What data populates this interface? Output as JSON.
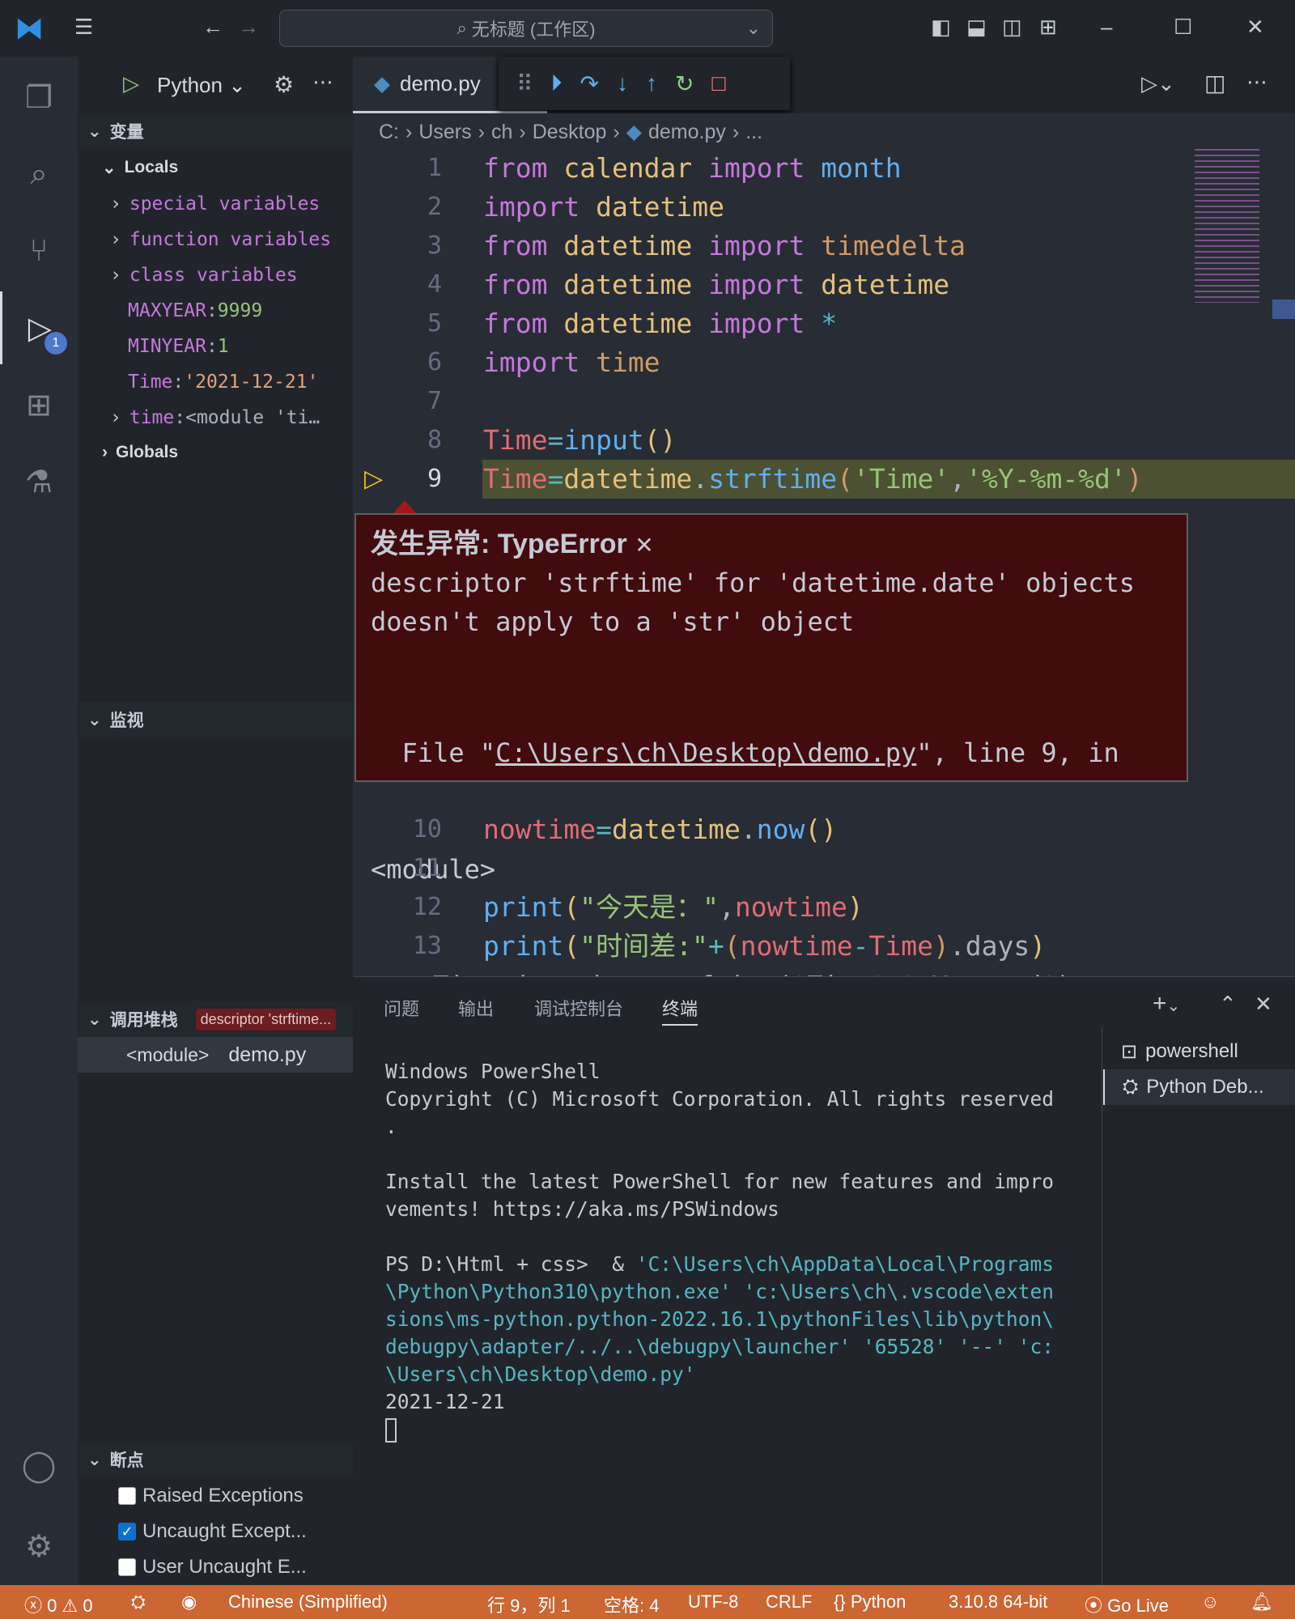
{
  "titlebar": {
    "title": "无标题 (工作区)",
    "search_icon": "search-icon"
  },
  "sidebar": {
    "run_config": "Python",
    "variables_header": "变量",
    "locals_label": "Locals",
    "locals": [
      {
        "label": "special variables",
        "expandable": true
      },
      {
        "label": "function variables",
        "expandable": true
      },
      {
        "label": "class variables",
        "expandable": true
      },
      {
        "name": "MAXYEAR",
        "value": "9999"
      },
      {
        "name": "MINYEAR",
        "value": "1"
      },
      {
        "name": "Time",
        "value": "'2021-12-21'"
      },
      {
        "name": "time",
        "value": "<module 'ti…",
        "expandable": true
      }
    ],
    "globals_label": "Globals",
    "watch_header": "监视",
    "callstack_header": "调用堆栈",
    "callstack_badge": "descriptor 'strftime...",
    "callstack_frame": {
      "name": "<module>",
      "file": "demo.py"
    },
    "breakpoints_header": "断点",
    "breakpoints": [
      {
        "label": "Raised Exceptions",
        "checked": false
      },
      {
        "label": "Uncaught Except...",
        "checked": true
      },
      {
        "label": "User Uncaught E...",
        "checked": false
      }
    ],
    "debug_badge": "1"
  },
  "tabs": [
    {
      "label": "demo.py",
      "active": true
    }
  ],
  "breadcrumb": [
    "C:",
    "Users",
    "ch",
    "Desktop",
    "demo.py",
    "..."
  ],
  "code_lines": [
    {
      "n": "1",
      "tokens": [
        [
          "from ",
          "k"
        ],
        [
          "calendar ",
          "m"
        ],
        [
          "import ",
          "k"
        ],
        [
          "month",
          "f"
        ]
      ]
    },
    {
      "n": "2",
      "tokens": [
        [
          "import ",
          "k"
        ],
        [
          "datetime",
          "m"
        ]
      ]
    },
    {
      "n": "3",
      "tokens": [
        [
          "from ",
          "k"
        ],
        [
          "datetime ",
          "m"
        ],
        [
          "import ",
          "k"
        ],
        [
          "timedelta",
          "t"
        ]
      ]
    },
    {
      "n": "4",
      "tokens": [
        [
          "from ",
          "k"
        ],
        [
          "datetime ",
          "m"
        ],
        [
          "import ",
          "k"
        ],
        [
          "datetime",
          "m"
        ]
      ]
    },
    {
      "n": "5",
      "tokens": [
        [
          "from ",
          "k"
        ],
        [
          "datetime ",
          "m"
        ],
        [
          "import ",
          "k"
        ],
        [
          "*",
          "o"
        ]
      ]
    },
    {
      "n": "6",
      "tokens": [
        [
          "import ",
          "k"
        ],
        [
          "time",
          "t"
        ]
      ]
    },
    {
      "n": "7",
      "tokens": []
    },
    {
      "n": "8",
      "tokens": [
        [
          "Time",
          "v"
        ],
        [
          "=",
          "o"
        ],
        [
          "input",
          "f"
        ],
        [
          "()",
          "y"
        ]
      ]
    },
    {
      "n": "9",
      "tokens": [
        [
          "Time",
          "v"
        ],
        [
          "=",
          "o"
        ],
        [
          "datetime",
          "m"
        ],
        [
          ".",
          "d"
        ],
        [
          "strftime",
          "f"
        ],
        [
          "(",
          "p"
        ],
        [
          "'Time'",
          "s"
        ],
        [
          ",",
          "d"
        ],
        [
          "'%Y-%m-%d'",
          "s"
        ],
        [
          ")",
          "p"
        ]
      ]
    }
  ],
  "code_lines_after": [
    {
      "n": "10",
      "tokens": [
        [
          "nowtime",
          "v"
        ],
        [
          "=",
          "o"
        ],
        [
          "datetime",
          "m"
        ],
        [
          ".",
          "d"
        ],
        [
          "now",
          "f"
        ],
        [
          "()",
          "y"
        ]
      ]
    },
    {
      "n": "11",
      "tokens": []
    },
    {
      "n": "12",
      "tokens": [
        [
          "print",
          "f"
        ],
        [
          "(",
          "y"
        ],
        [
          "\"今天是：\"",
          "s"
        ],
        [
          ",",
          "d"
        ],
        [
          "nowtime",
          "v"
        ],
        [
          ")",
          "y"
        ]
      ]
    },
    {
      "n": "13",
      "tokens": [
        [
          "print",
          "f"
        ],
        [
          "(",
          "y"
        ],
        [
          "\"时间差:\"",
          "s"
        ],
        [
          "+",
          "o"
        ],
        [
          "(",
          "p"
        ],
        [
          "nowtime",
          "v"
        ],
        [
          "-",
          "o"
        ],
        [
          "Time",
          "v"
        ],
        [
          ")",
          "p"
        ],
        [
          ".days",
          "d"
        ],
        [
          ")",
          "y"
        ]
      ]
    }
  ],
  "exception": {
    "title": "发生异常: TypeError",
    "message1": "descriptor 'strftime' for 'datetime.date' objects",
    "message2": "doesn't apply to a 'str' object",
    "file_prefix": "  File \"",
    "file_link": "C:\\Users\\ch\\Desktop\\demo.py",
    "file_suffix": "\", line 9, in",
    "module": "<module>",
    "source": "    Time=datetime.strftime('Time','%Y-%m-%d')"
  },
  "panel": {
    "tabs": [
      "问题",
      "输出",
      "调试控制台",
      "终端"
    ],
    "active_tab": "终端",
    "terminals": [
      "powershell",
      "Python Deb..."
    ],
    "terminal_lines": [
      [
        "Windows PowerShell",
        ""
      ],
      [
        "Copyright (C) Microsoft Corporation. All rights reserved",
        ""
      ],
      [
        ".",
        ""
      ],
      [
        "",
        ""
      ],
      [
        "Install the latest PowerShell for new features and impro",
        ""
      ],
      [
        "vements! https://aka.ms/PSWindows",
        ""
      ],
      [
        "",
        ""
      ],
      [
        "PS D:\\Html + css>  & ",
        "'C:\\Users\\ch\\AppData\\Local\\Programs"
      ],
      [
        "",
        "\\Python\\Python310\\python.exe' 'c:\\Users\\ch\\.vscode\\exten"
      ],
      [
        "",
        "sions\\ms-python.python-2022.16.1\\pythonFiles\\lib\\python\\"
      ],
      [
        "",
        "debugpy\\adapter/../..\\debugpy\\launcher' '65528' '--' 'c:"
      ],
      [
        "",
        "\\Users\\ch\\Desktop\\demo.py'"
      ],
      [
        "2021-12-21",
        ""
      ]
    ]
  },
  "status": {
    "errors": "0",
    "warnings": "0",
    "language_pack": "Chinese (Simplified)",
    "position": "行 9，列 1",
    "spaces": "空格: 4",
    "encoding": "UTF-8",
    "eol": "CRLF",
    "language": "Python",
    "interpreter": "3.10.8 64-bit",
    "golive": "Go Live"
  },
  "colors": {
    "status_bar": "#cc6633",
    "exception_bg": "#420b0e",
    "current_line": "#4b5132",
    "accent": "#0e70d0"
  }
}
